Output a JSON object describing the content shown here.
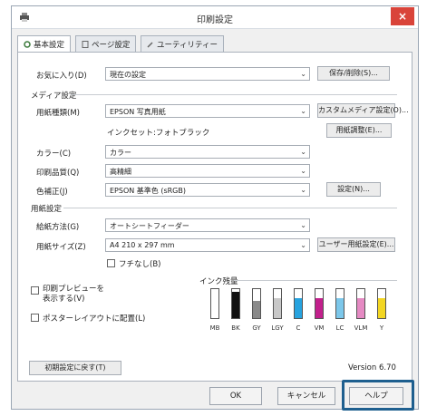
{
  "window": {
    "title": "印刷設定",
    "close": "×"
  },
  "tabs": [
    {
      "label": "基本設定"
    },
    {
      "label": "ページ設定"
    },
    {
      "label": "ユーティリティー"
    }
  ],
  "favorites": {
    "label": "お気に入り(D)",
    "value": "現在の設定",
    "save_button": "保存/削除(S)..."
  },
  "media": {
    "section": "メディア設定",
    "type_label": "用紙種類(M)",
    "type_value": "EPSON 写真用紙",
    "custom_button": "カスタムメディア設定(O)...",
    "ink_type": "インクセット:フォトブラック",
    "adjust_button": "用紙調整(E)...",
    "color_label": "カラー(C)",
    "color_value": "カラー",
    "quality_label": "印刷品質(Q)",
    "quality_value": "高精細",
    "correction_label": "色補正(J)",
    "correction_value": "EPSON 基準色 (sRGB)",
    "settings_button": "設定(N)..."
  },
  "paper": {
    "section": "用紙設定",
    "source_label": "給紙方法(G)",
    "source_value": "オートシートフィーダー",
    "size_label": "用紙サイズ(Z)",
    "size_value": "A4 210 x 297 mm",
    "user_size_button": "ユーザー用紙設定(E)...",
    "borderless_label": "フチなし(B)"
  },
  "options": {
    "preview_label": "印刷プレビューを\n表示する(V)",
    "poster_label": "ポスターレイアウトに配置(L)"
  },
  "ink": {
    "title": "インク残量",
    "colors": [
      {
        "name": "MB",
        "color": "#ffffff",
        "level": 0.0
      },
      {
        "name": "BK",
        "color": "#111111",
        "level": 0.9
      },
      {
        "name": "GY",
        "color": "#8a8a8a",
        "level": 0.6
      },
      {
        "name": "LGY",
        "color": "#c8c8c8",
        "level": 0.7
      },
      {
        "name": "C",
        "color": "#27a3df",
        "level": 0.7
      },
      {
        "name": "VM",
        "color": "#c2208c",
        "level": 0.7
      },
      {
        "name": "LC",
        "color": "#7cc7ea",
        "level": 0.7
      },
      {
        "name": "VLM",
        "color": "#e58ac3",
        "level": 0.7
      },
      {
        "name": "Y",
        "color": "#f3d622",
        "level": 0.7
      }
    ]
  },
  "reset_button": "初期設定に戻す(T)",
  "version": "Version 6.70",
  "buttons": {
    "ok": "OK",
    "cancel": "キャンセル",
    "help": "ヘルプ"
  },
  "colors": {
    "close_bg": "#d9443a",
    "highlight": "#1e5f8f"
  }
}
